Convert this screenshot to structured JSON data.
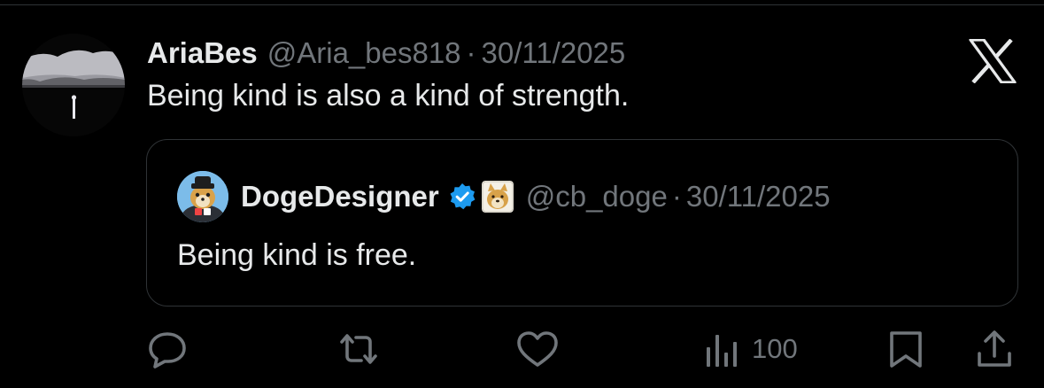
{
  "post": {
    "author_name": "AriaBes",
    "author_handle": "@Aria_bes818",
    "separator": "·",
    "date": "30/11/2025",
    "text": "Being kind is also a kind of strength."
  },
  "quoted_post": {
    "author_name": "DogeDesigner",
    "author_handle": "@cb_doge",
    "separator": "·",
    "date": "30/11/2025",
    "text": "Being kind is free.",
    "verified": true
  },
  "actions": {
    "views_count": "100"
  },
  "icons": {
    "brand": "x-logo-icon",
    "verified": "verified-badge-icon",
    "affiliate": "doge-affiliate-badge-icon",
    "reply": "reply-icon",
    "repost": "repost-icon",
    "like": "heart-icon",
    "views": "views-icon",
    "bookmark": "bookmark-icon",
    "share": "share-icon"
  },
  "colors": {
    "background": "#000000",
    "primary_text": "#e7e9ea",
    "secondary_text": "#71767b",
    "border": "#2f3336",
    "verified_blue": "#1d9bf0"
  }
}
